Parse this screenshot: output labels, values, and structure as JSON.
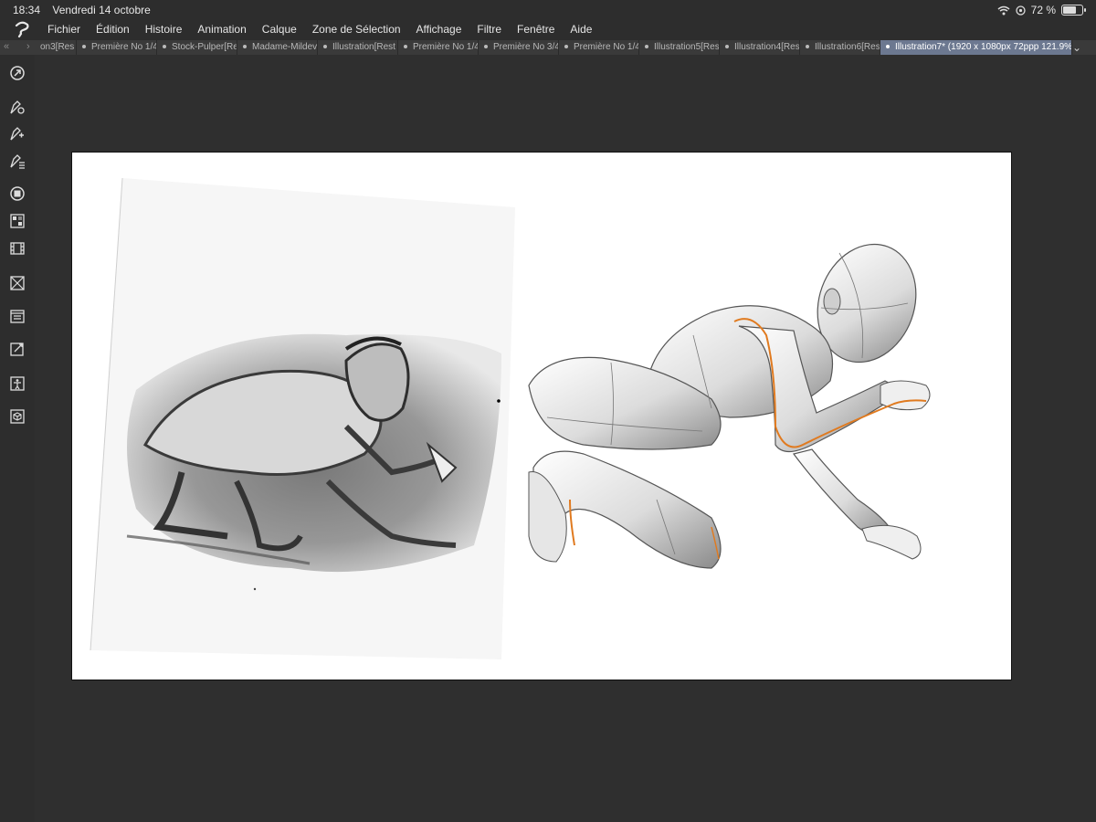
{
  "status_bar": {
    "time": "18:34",
    "date": "Vendredi 14 octobre",
    "battery": "72 %",
    "battery_level": 0.72
  },
  "menu": {
    "items": [
      "Fichier",
      "Édition",
      "Histoire",
      "Animation",
      "Calque",
      "Zone de Sélection",
      "Affichage",
      "Filtre",
      "Fenêtre",
      "Aide"
    ]
  },
  "tabs": {
    "prev_icon": "double-chevron-left-icon",
    "next_icon": "chevron-right-icon",
    "items": [
      {
        "label": "on3[Res"
      },
      {
        "label": "Première No 1/4"
      },
      {
        "label": "Stock-Pulper[Re"
      },
      {
        "label": "Madame-Mildev"
      },
      {
        "label": "Illustration[Rest"
      },
      {
        "label": "Première No 1/4"
      },
      {
        "label": "Première No 3/4"
      },
      {
        "label": "Première No 1/4"
      },
      {
        "label": "Illustration5[Res"
      },
      {
        "label": "Illustration4[Res"
      },
      {
        "label": "Illustration6[Res"
      },
      {
        "label": "Illustration7* (1920 x 1080px 72ppp 121.9%)"
      }
    ],
    "active_index": 11
  },
  "toolbar": {
    "tools": [
      "navigator-icon",
      "pen-settings-icon",
      "sub-tool-icon",
      "tool-property-icon",
      "color-wheel-icon",
      "color-set-icon",
      "timeline-icon",
      "material-icon",
      "layer-property-icon",
      "layer-icon",
      "accessibility-icon",
      "3d-object-icon"
    ]
  },
  "colors": {
    "accent_tab": "#6c7890",
    "background": "#2d2d2d",
    "canvas": "#ffffff",
    "guide_line": "#e07a1f"
  }
}
